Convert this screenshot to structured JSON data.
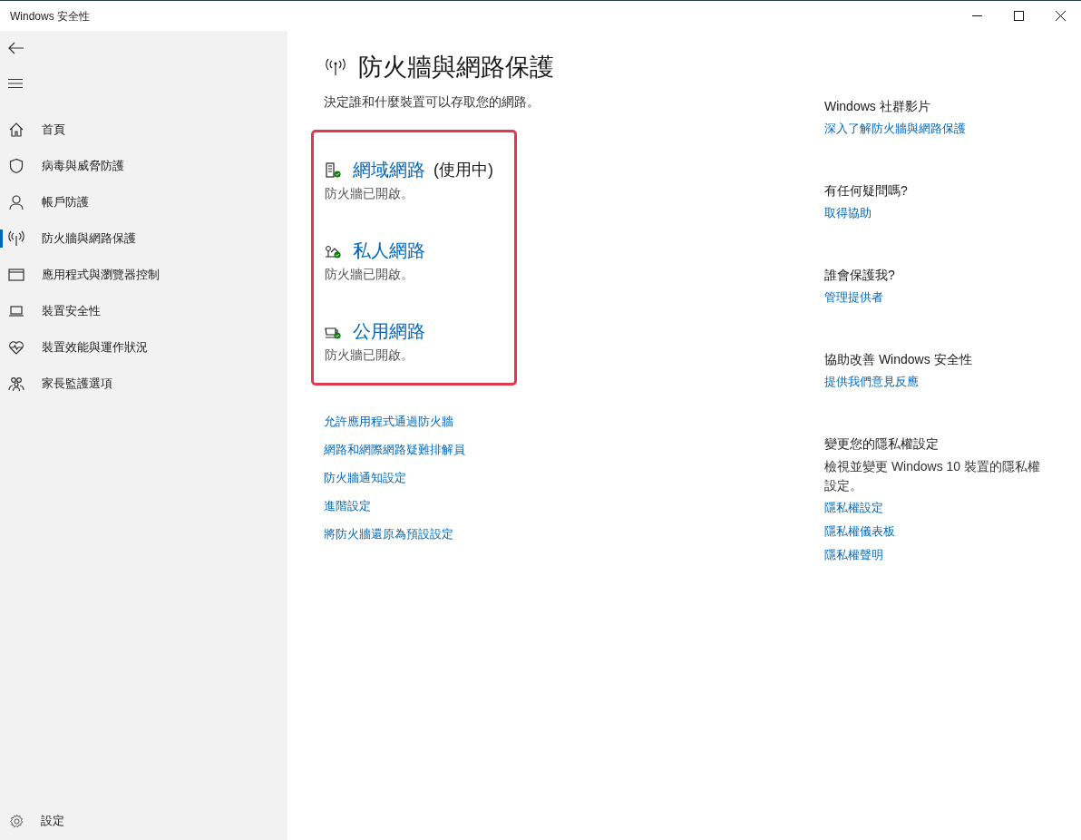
{
  "window": {
    "title": "Windows 安全性"
  },
  "sidebar": {
    "items": [
      {
        "kind": "home",
        "label": "首頁",
        "selected": false
      },
      {
        "kind": "shield",
        "label": "病毒與威脅防護",
        "selected": false
      },
      {
        "kind": "person",
        "label": "帳戶防護",
        "selected": false
      },
      {
        "kind": "antenna",
        "label": "防火牆與網路保護",
        "selected": true
      },
      {
        "kind": "browser",
        "label": "應用程式與瀏覽器控制",
        "selected": false
      },
      {
        "kind": "laptop",
        "label": "裝置安全性",
        "selected": false
      },
      {
        "kind": "heart",
        "label": "裝置效能與運作狀況",
        "selected": false
      },
      {
        "kind": "family",
        "label": "家長監護選項",
        "selected": false
      }
    ],
    "settings": {
      "label": "設定"
    }
  },
  "page": {
    "title": "防火牆與網路保護",
    "subtitle": "決定誰和什麼裝置可以存取您的網路。",
    "networks": [
      {
        "kind": "domain",
        "name": "網域網路",
        "note": "(使用中)",
        "status": "防火牆已開啟。"
      },
      {
        "kind": "private",
        "name": "私人網路",
        "status": "防火牆已開啟。"
      },
      {
        "kind": "public",
        "name": "公用網路",
        "status": "防火牆已開啟。"
      }
    ],
    "links": [
      "允許應用程式通過防火牆",
      "網路和網際網路疑難排解員",
      "防火牆通知設定",
      "進階設定",
      "將防火牆還原為預設設定"
    ]
  },
  "side_panel": [
    {
      "heading": "Windows 社群影片",
      "links": [
        "深入了解防火牆與網路保護"
      ]
    },
    {
      "heading": "有任何疑問嗎?",
      "links": [
        "取得協助"
      ]
    },
    {
      "heading": "誰會保護我?",
      "links": [
        "管理提供者"
      ]
    },
    {
      "heading": "協助改善 Windows 安全性",
      "links": [
        "提供我們意見反應"
      ]
    },
    {
      "heading": "變更您的隱私權設定",
      "text": "檢視並變更 Windows 10 裝置的隱私權設定。",
      "links": [
        "隱私權設定",
        "隱私權儀表板",
        "隱私權聲明"
      ]
    }
  ]
}
